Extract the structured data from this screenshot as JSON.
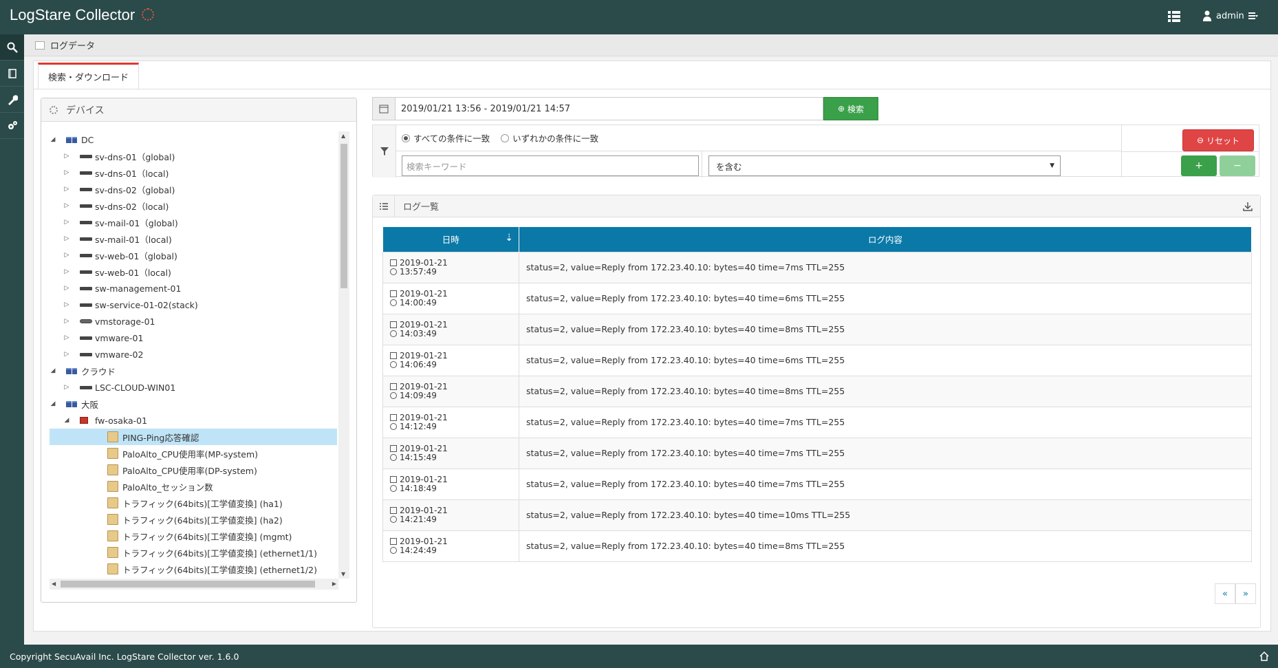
{
  "header": {
    "app_title": "LogStare Collector",
    "user": "admin"
  },
  "breadcrumb": {
    "label": "ログデータ"
  },
  "tab": {
    "label": "検索・ダウンロード"
  },
  "device_panel": {
    "title": "デバイス"
  },
  "tree": [
    {
      "label": "DC",
      "level": 0,
      "icon": "group",
      "toggle": "down"
    },
    {
      "label": "sv-dns-01（global)",
      "level": 1,
      "icon": "server",
      "toggle": "right"
    },
    {
      "label": "sv-dns-01（local)",
      "level": 1,
      "icon": "server",
      "toggle": "right"
    },
    {
      "label": "sv-dns-02（global)",
      "level": 1,
      "icon": "server",
      "toggle": "right"
    },
    {
      "label": "sv-dns-02（local)",
      "level": 1,
      "icon": "server",
      "toggle": "right"
    },
    {
      "label": "sv-mail-01（global)",
      "level": 1,
      "icon": "server",
      "toggle": "right"
    },
    {
      "label": "sv-mail-01（local)",
      "level": 1,
      "icon": "server",
      "toggle": "right"
    },
    {
      "label": "sv-web-01（global)",
      "level": 1,
      "icon": "server",
      "toggle": "right"
    },
    {
      "label": "sv-web-01（local)",
      "level": 1,
      "icon": "server",
      "toggle": "right"
    },
    {
      "label": "sw-management-01",
      "level": 1,
      "icon": "server",
      "toggle": "right"
    },
    {
      "label": "sw-service-01-02(stack)",
      "level": 1,
      "icon": "server",
      "toggle": "right"
    },
    {
      "label": "vmstorage-01",
      "level": 1,
      "icon": "storage",
      "toggle": "right"
    },
    {
      "label": "vmware-01",
      "level": 1,
      "icon": "server",
      "toggle": "right"
    },
    {
      "label": "vmware-02",
      "level": 1,
      "icon": "server",
      "toggle": "right"
    },
    {
      "label": "クラウド",
      "level": 0,
      "icon": "group",
      "toggle": "down"
    },
    {
      "label": "LSC-CLOUD-WIN01",
      "level": 1,
      "icon": "server",
      "toggle": "right"
    },
    {
      "label": "大阪",
      "level": 0,
      "icon": "group",
      "toggle": "down"
    },
    {
      "label": "fw-osaka-01",
      "level": 1,
      "icon": "fw",
      "toggle": "down"
    },
    {
      "label": "PING-Ping応答確認",
      "level": 2,
      "icon": "folder",
      "toggle": "",
      "selected": true
    },
    {
      "label": "PaloAlto_CPU使用率(MP-system)",
      "level": 2,
      "icon": "folder",
      "toggle": ""
    },
    {
      "label": "PaloAlto_CPU使用率(DP-system)",
      "level": 2,
      "icon": "folder",
      "toggle": ""
    },
    {
      "label": "PaloAlto_セッション数",
      "level": 2,
      "icon": "folder",
      "toggle": ""
    },
    {
      "label": "トラフィック(64bits)[工学値変換] (ha1)",
      "level": 2,
      "icon": "folder",
      "toggle": ""
    },
    {
      "label": "トラフィック(64bits)[工学値変換] (ha2)",
      "level": 2,
      "icon": "folder",
      "toggle": ""
    },
    {
      "label": "トラフィック(64bits)[工学値変換] (mgmt)",
      "level": 2,
      "icon": "folder",
      "toggle": ""
    },
    {
      "label": "トラフィック(64bits)[工学値変換] (ethernet1/1)",
      "level": 2,
      "icon": "folder",
      "toggle": ""
    },
    {
      "label": "トラフィック(64bits)[工学値変換] (ethernet1/2)",
      "level": 2,
      "icon": "folder",
      "toggle": ""
    }
  ],
  "search": {
    "date_range": "2019/01/21 13:56 - 2019/01/21 14:57",
    "search_button": "検索",
    "match_all": "すべての条件に一致",
    "match_any": "いずれかの条件に一致",
    "keyword_placeholder": "検索キーワード",
    "condition": "を含む",
    "reset_button": "リセット",
    "add_button": "+",
    "remove_button": "−"
  },
  "log_panel": {
    "title": "ログ一覧",
    "col_datetime": "日時",
    "col_content": "ログ内容",
    "rows": [
      {
        "date": "2019-01-21",
        "time": "13:57:49",
        "content": "status=2, value=Reply from 172.23.40.10: bytes=40 time=7ms TTL=255"
      },
      {
        "date": "2019-01-21",
        "time": "14:00:49",
        "content": "status=2, value=Reply from 172.23.40.10: bytes=40 time=6ms TTL=255"
      },
      {
        "date": "2019-01-21",
        "time": "14:03:49",
        "content": "status=2, value=Reply from 172.23.40.10: bytes=40 time=8ms TTL=255"
      },
      {
        "date": "2019-01-21",
        "time": "14:06:49",
        "content": "status=2, value=Reply from 172.23.40.10: bytes=40 time=6ms TTL=255"
      },
      {
        "date": "2019-01-21",
        "time": "14:09:49",
        "content": "status=2, value=Reply from 172.23.40.10: bytes=40 time=8ms TTL=255"
      },
      {
        "date": "2019-01-21",
        "time": "14:12:49",
        "content": "status=2, value=Reply from 172.23.40.10: bytes=40 time=7ms TTL=255"
      },
      {
        "date": "2019-01-21",
        "time": "14:15:49",
        "content": "status=2, value=Reply from 172.23.40.10: bytes=40 time=7ms TTL=255"
      },
      {
        "date": "2019-01-21",
        "time": "14:18:49",
        "content": "status=2, value=Reply from 172.23.40.10: bytes=40 time=7ms TTL=255"
      },
      {
        "date": "2019-01-21",
        "time": "14:21:49",
        "content": "status=2, value=Reply from 172.23.40.10: bytes=40 time=10ms TTL=255"
      },
      {
        "date": "2019-01-21",
        "time": "14:24:49",
        "content": "status=2, value=Reply from 172.23.40.10: bytes=40 time=8ms TTL=255"
      }
    ],
    "pager_prev": "«",
    "pager_next": "»"
  },
  "footer": {
    "copyright": "Copyright SecuAvail Inc. LogStare Collector ver. 1.6.0"
  },
  "colors": {
    "header_bg": "#2b4a4a",
    "accent_blue": "#0b79a8",
    "green": "#3aa04a",
    "red": "#e04545"
  }
}
